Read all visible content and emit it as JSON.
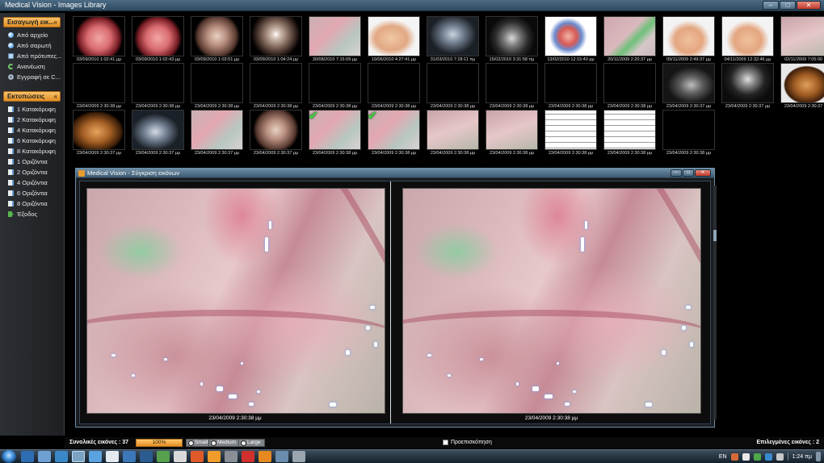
{
  "window": {
    "title": "Medical Vision - Images Library"
  },
  "sidebar": {
    "import_header": "Εισαγωγή εικ...",
    "import_items": [
      {
        "label": "Από αρχείο",
        "icon": "dot"
      },
      {
        "label": "Από σαρωτή",
        "icon": "dot"
      },
      {
        "label": "Από πρότυπες...",
        "icon": "monitor"
      },
      {
        "label": "Ανανέωση",
        "icon": "refresh"
      },
      {
        "label": "Εγγραφή σε C...",
        "icon": "cd"
      }
    ],
    "print_header": "Εκτυπώσεις",
    "print_items": [
      {
        "label": "1 Κατακόρυφη",
        "icon": "doc"
      },
      {
        "label": "2 Κατακόρυφη",
        "icon": "doc"
      },
      {
        "label": "4 Κατακόρυφη",
        "icon": "doc"
      },
      {
        "label": "6 Κατακόρυφη",
        "icon": "doc"
      },
      {
        "label": "8 Κατακόρυφη",
        "icon": "doc"
      },
      {
        "label": "1 Οριζόντια",
        "icon": "doc"
      },
      {
        "label": "2 Οριζόντια",
        "icon": "doc"
      },
      {
        "label": "4 Οριζόντια",
        "icon": "doc"
      },
      {
        "label": "6 Οριζόντια",
        "icon": "doc"
      },
      {
        "label": "8 Οριζόντια",
        "icon": "doc"
      },
      {
        "label": "Έξοδος",
        "icon": "exit"
      }
    ]
  },
  "thumbnails": {
    "row1": [
      {
        "caption": "03/09/2010 1:02:41 μμ",
        "kind": "k-endo",
        "checked": false
      },
      {
        "caption": "03/09/2010 1:02:43 μμ",
        "kind": "k-endo",
        "checked": false
      },
      {
        "caption": "03/09/2010 1:03:51 μμ",
        "kind": "k-endo2",
        "checked": false
      },
      {
        "caption": "03/09/2010 1:04:24 μμ",
        "kind": "k-endo3",
        "checked": false
      },
      {
        "caption": "30/08/2010 7:15:09 μμ",
        "kind": "k-pink",
        "checked": false
      },
      {
        "caption": "19/06/2010 4:27:41 μμ",
        "kind": "k-skin",
        "checked": false
      },
      {
        "caption": "31/03/2010 7:28:11 πμ",
        "kind": "k-xray",
        "checked": false
      },
      {
        "caption": "15/02/2010 3:31:58 πμ",
        "kind": "k-ct",
        "checked": false
      },
      {
        "caption": "13/02/2010 12:15:40 μμ",
        "kind": "k-illus",
        "checked": false
      },
      {
        "caption": "20/11/2009 2:20:37 μμ",
        "kind": "k-green",
        "checked": false
      },
      {
        "caption": "09/11/2009 2:49:37 μμ",
        "kind": "k-breast",
        "checked": false
      },
      {
        "caption": "04/11/2009 12:32:46 μμ",
        "kind": "k-breast",
        "checked": false
      },
      {
        "caption": "02/11/2009 7:05:00 μμ",
        "kind": "k-pink2",
        "checked": false
      }
    ],
    "row2": [
      {
        "caption": "23/04/2009 2:30:38 μμ",
        "kind": "k-dark3d",
        "checked": false
      },
      {
        "caption": "23/04/2009 2:30:38 μμ",
        "kind": "k-dark3d",
        "checked": false
      },
      {
        "caption": "23/04/2009 2:30:38 μμ",
        "kind": "k-dark3d",
        "checked": false
      },
      {
        "caption": "23/04/2009 2:30:38 μμ",
        "kind": "k-dark3d",
        "checked": false
      },
      {
        "caption": "23/04/2009 2:30:38 μμ",
        "kind": "k-dark3d",
        "checked": false
      },
      {
        "caption": "23/04/2009 2:30:38 μμ",
        "kind": "k-dark3d",
        "checked": false
      },
      {
        "caption": "23/04/2009 2:30:38 μμ",
        "kind": "k-dark3d",
        "checked": false
      },
      {
        "caption": "23/04/2009 2:30:38 μμ",
        "kind": "k-dark3d",
        "checked": false
      },
      {
        "caption": "23/04/2009 2:30:38 μμ",
        "kind": "k-dark3d",
        "checked": false
      },
      {
        "caption": "23/04/2009 2:30:38 μμ",
        "kind": "k-dark3d",
        "checked": false
      },
      {
        "caption": "23/04/2009 2:30:37 μμ",
        "kind": "k-us",
        "checked": false
      },
      {
        "caption": "23/04/2009 2:30:37 μμ",
        "kind": "k-us2",
        "checked": false
      },
      {
        "caption": "23/04/2009 2:30:37 μμ",
        "kind": "k-fetus",
        "checked": false
      }
    ],
    "row3": [
      {
        "caption": "23/04/2009 2:30:37 μμ",
        "kind": "k-fetus2",
        "checked": false
      },
      {
        "caption": "23/04/2009 2:30:37 μμ",
        "kind": "k-us3",
        "checked": false
      },
      {
        "caption": "23/04/2009 2:30:37 μμ",
        "kind": "k-pink",
        "checked": false
      },
      {
        "caption": "23/04/2009 2:30:37 μμ",
        "kind": "k-endo2",
        "checked": false
      },
      {
        "caption": "23/04/2009 2:30:38 μμ",
        "kind": "k-pink",
        "checked": true
      },
      {
        "caption": "23/04/2009 2:30:38 μμ",
        "kind": "k-pink",
        "checked": true
      },
      {
        "caption": "23/04/2009 2:30:38 μμ",
        "kind": "k-pink2",
        "checked": false
      },
      {
        "caption": "23/04/2009 2:30:38 μμ",
        "kind": "k-pink2",
        "checked": false
      },
      {
        "caption": "23/04/2009 2:30:38 μμ",
        "kind": "k-doc",
        "checked": false
      },
      {
        "caption": "23/04/2009 2:30:38 μμ",
        "kind": "k-doc",
        "checked": false
      },
      {
        "caption": "23/04/2009 2:30:38 μμ",
        "kind": "k-doc2",
        "checked": false
      }
    ]
  },
  "compare_window": {
    "title": "Medical Vision - Σύγκριση εικόνων",
    "left_caption": "23/04/2009 2:30:38 μμ",
    "right_caption": "23/04/2009 2:30:38 μμ"
  },
  "statusbar": {
    "total_label": "Συνολικές εικόνες : 37",
    "zoom": "100%",
    "size_small": "Small",
    "size_medium": "Medium",
    "size_large": "Large",
    "preview_label": "Προεπισκόπηση",
    "selected_label": "Επιλεγμένες εικόνες : 2"
  },
  "taskbar": {
    "language": "EN",
    "clock": "1:24 πμ"
  },
  "colors": {
    "accent_orange": "#e08f25",
    "title_blue": "#3c5a71",
    "check_green": "#3fcf3f"
  }
}
